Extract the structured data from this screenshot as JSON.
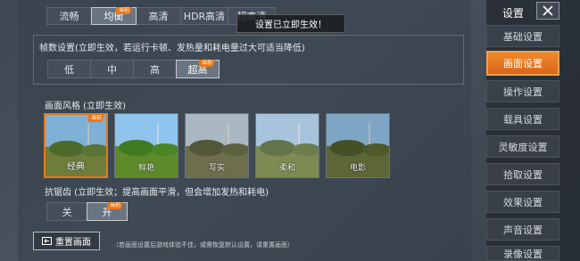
{
  "quality": {
    "options": [
      "流畅",
      "均衡",
      "高清",
      "HDR高清",
      "超高清"
    ],
    "selected": "均衡",
    "current_tag": "当前"
  },
  "toast": "设置已立即生效！",
  "fps": {
    "title": "帧数设置(立即生效，若运行卡顿、发热量和耗电量过大可适当降低)",
    "options": [
      "低",
      "中",
      "高",
      "超高"
    ],
    "selected": "超高",
    "current_tag": "当前"
  },
  "style": {
    "title": "画面风格 (立即生效)",
    "options": [
      "经典",
      "鲜艳",
      "写实",
      "柔和",
      "电影"
    ],
    "selected": "经典",
    "current_tag": "当前"
  },
  "aa": {
    "title": "抗锯齿 (立即生效；提高画面平滑，但会增加发热和耗电)",
    "options": [
      "关",
      "开"
    ],
    "selected": "开",
    "current_tag": "当前"
  },
  "reset": {
    "label": "重置画面",
    "note": "（若画面设置后游戏体验不佳，或需恢复默认设置，请重置画面）"
  },
  "sidebar": {
    "title": "设置",
    "items": [
      "基础设置",
      "画面设置",
      "操作设置",
      "载具设置",
      "灵敏度设置",
      "拾取设置",
      "效果设置",
      "声音设置",
      "录像设置"
    ],
    "selected": "画面设置"
  },
  "colors": {
    "accent": "#e8791a",
    "panel": "#3e4852"
  }
}
